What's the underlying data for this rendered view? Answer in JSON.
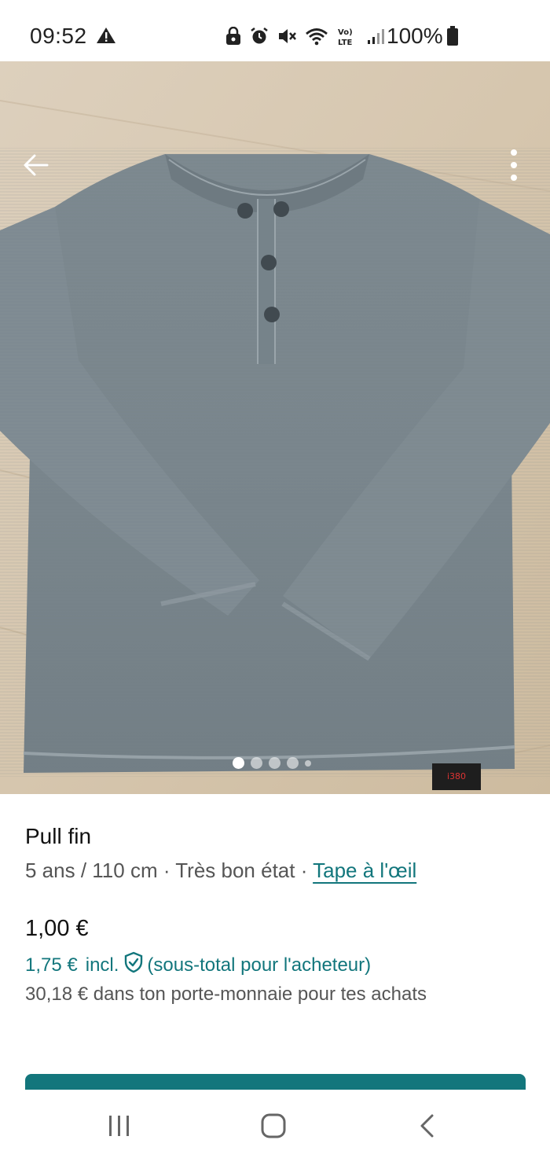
{
  "status_bar": {
    "time": "09:52",
    "battery_percent": "100%",
    "icons": [
      "alert-triangle-icon",
      "lock-icon",
      "alarm-icon",
      "mute-icon",
      "wifi-icon",
      "volte-icon",
      "signal-icon",
      "battery-icon"
    ]
  },
  "photo": {
    "carousel_count": 5,
    "active_index": 0,
    "actions": [
      "back-arrow-icon",
      "more-vert-icon"
    ],
    "label_text": "i380"
  },
  "item": {
    "title": "Pull fin",
    "size": "5 ans / 110 cm",
    "separator": " · ",
    "condition": "Très bon état",
    "brand": "Tape à l'œil",
    "price": "1,00 €",
    "price_with_fee": "1,75 €",
    "incl_label": "incl.",
    "fee_note": "(sous-total pour l'acheteur)",
    "wallet_note": "30,18 € dans ton porte-monnaie pour tes achats"
  },
  "colors": {
    "accent": "#12767c",
    "button": "#13767c",
    "text_primary": "#111111",
    "text_secondary": "#555555"
  },
  "nav_bar": {
    "icons": [
      "recent-apps-icon",
      "home-icon",
      "back-icon"
    ]
  }
}
